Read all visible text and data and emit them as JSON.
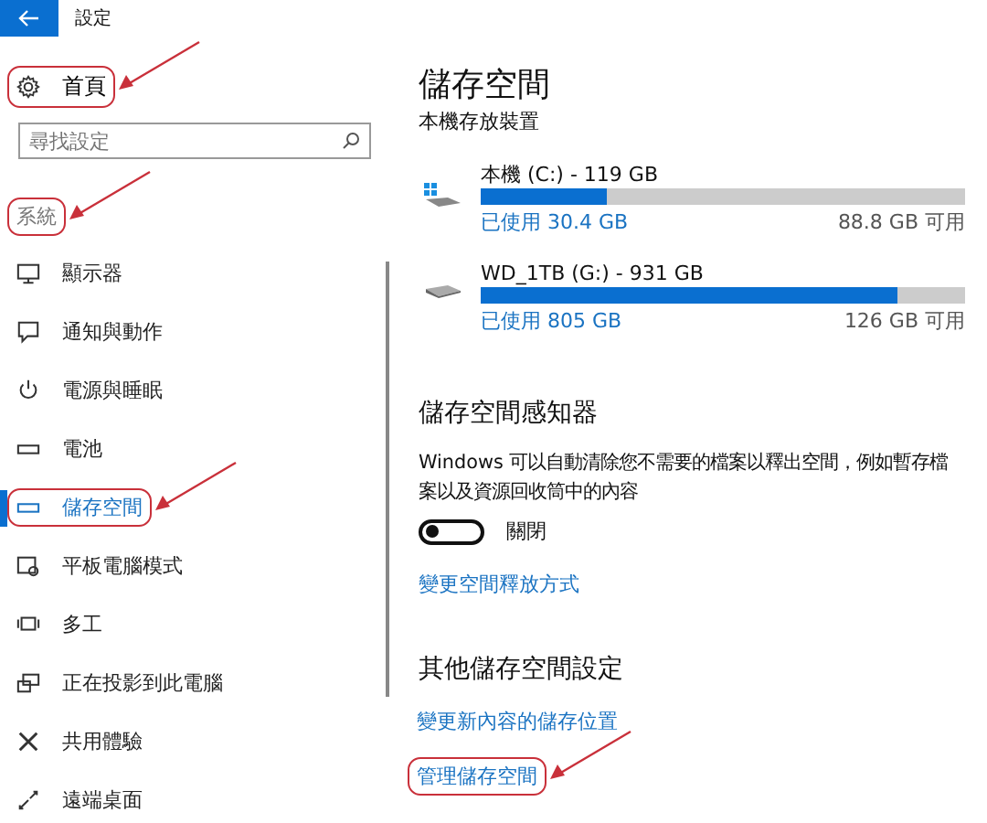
{
  "window": {
    "title": "設定"
  },
  "sidebar": {
    "home": {
      "label": "首頁",
      "circled": true
    },
    "search": {
      "placeholder": "尋找設定"
    },
    "section": {
      "label": "系統",
      "circled": true
    },
    "items": [
      {
        "label": "顯示器",
        "kind": "display",
        "selected": false,
        "circled": false
      },
      {
        "label": "通知與動作",
        "kind": "notification",
        "selected": false,
        "circled": false
      },
      {
        "label": "電源與睡眠",
        "kind": "power",
        "selected": false,
        "circled": false
      },
      {
        "label": "電池",
        "kind": "battery",
        "selected": false,
        "circled": false
      },
      {
        "label": "儲存空間",
        "kind": "storage",
        "selected": true,
        "circled": true
      },
      {
        "label": "平板電腦模式",
        "kind": "tablet",
        "selected": false,
        "circled": false
      },
      {
        "label": "多工",
        "kind": "multitask",
        "selected": false,
        "circled": false
      },
      {
        "label": "正在投影到此電腦",
        "kind": "project",
        "selected": false,
        "circled": false
      },
      {
        "label": "共用體驗",
        "kind": "share",
        "selected": false,
        "circled": false
      },
      {
        "label": "遠端桌面",
        "kind": "remote",
        "selected": false,
        "circled": false
      }
    ]
  },
  "content": {
    "title": "儲存空間",
    "subtitle": "本機存放裝置",
    "drives": [
      {
        "kind": "system",
        "name": "本機 (C:) - 119 GB",
        "level": 0.26,
        "used": "已使用 30.4 GB",
        "free": "88.8 GB 可用"
      },
      {
        "kind": "external",
        "name": "WD_1TB (G:) - 931 GB",
        "level": 0.86,
        "used": "已使用 805 GB",
        "free": "126 GB 可用"
      }
    ],
    "sense": {
      "heading": "儲存空間感知器",
      "description": "Windows 可以自動清除您不需要的檔案以釋出空間，例如暫存檔案以及資源回收筒中的內容",
      "toggle": {
        "on": false,
        "label": "關閉"
      },
      "link": "變更空間釋放方式"
    },
    "more": {
      "heading": "其他儲存空間設定",
      "links": [
        {
          "label": "變更新內容的儲存位置",
          "circled": false
        },
        {
          "label": "管理儲存空間",
          "circled": true
        }
      ]
    }
  }
}
